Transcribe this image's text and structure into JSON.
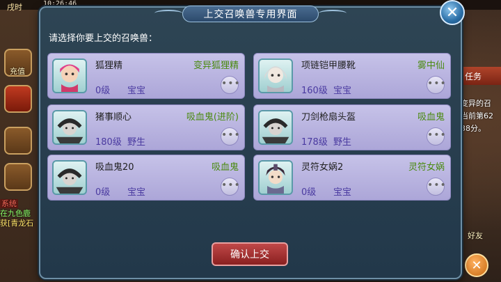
{
  "status": {
    "day_label": "戌时",
    "time": "10:26:46"
  },
  "side_icons": {
    "recharge_label": "充值",
    "friends_label": "好友",
    "task_label": "任务"
  },
  "chat": {
    "sys_tag": "系统",
    "line1": "在九色鹿",
    "line2": "获[青龙石"
  },
  "right_text": {
    "line1": "变异的召",
    "line2": "当前第62",
    "line3": "38分。"
  },
  "dialog": {
    "title": "上交召唤兽专用界面",
    "prompt": "请选择你要上交的召唤兽：",
    "confirm_label": "确认上交",
    "more_label": "•••"
  },
  "pets": [
    {
      "name": "狐狸精",
      "type": "变异狐狸精",
      "level": "0级",
      "kind": "宝宝",
      "avatar_icon": "fox-girl-avatar"
    },
    {
      "name": "项链铠甲腰靴",
      "type": "雾中仙",
      "level": "160级",
      "kind": "宝宝",
      "avatar_icon": "white-hair-avatar"
    },
    {
      "name": "猪事顺心",
      "type": "吸血鬼(进阶)",
      "level": "180级",
      "kind": "野生",
      "avatar_icon": "vampire-avatar"
    },
    {
      "name": "刀剑枪扇头盔",
      "type": "吸血鬼",
      "level": "178级",
      "kind": "野生",
      "avatar_icon": "vampire-avatar"
    },
    {
      "name": "吸血鬼20",
      "type": "吸血鬼",
      "level": "0级",
      "kind": "宝宝",
      "avatar_icon": "vampire-avatar"
    },
    {
      "name": "灵符女娲2",
      "type": "灵符女娲",
      "level": "0级",
      "kind": "宝宝",
      "avatar_icon": "nuwa-avatar"
    }
  ],
  "colors": {
    "card_bg": "#b8b3e0",
    "type_text": "#4a8a10",
    "level_text": "#4a3aa0",
    "confirm_bg": "#a83030"
  }
}
